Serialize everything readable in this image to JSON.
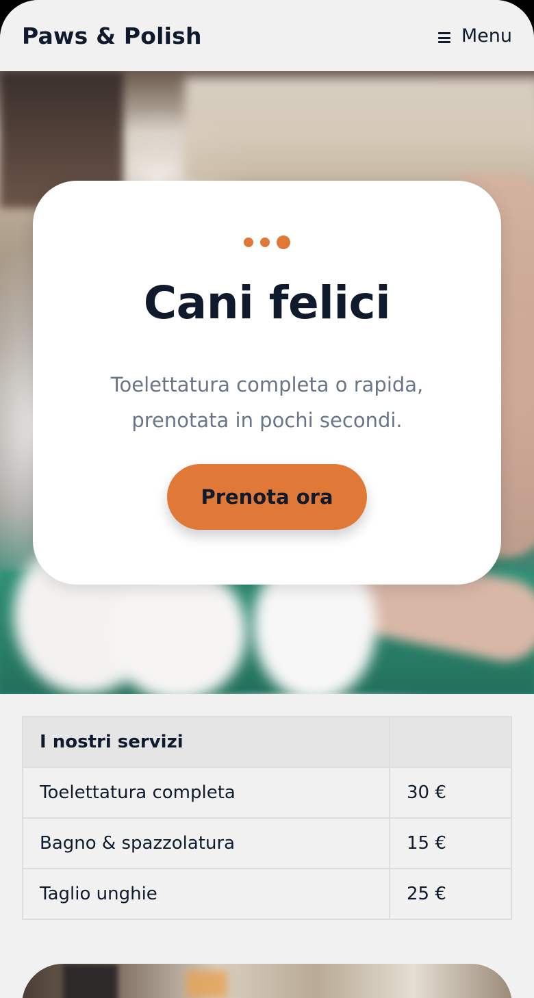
{
  "header": {
    "brand": "Paws & Polish",
    "menu_label": "Menu",
    "menu_icon": "hamburger-icon"
  },
  "hero": {
    "image": "dog-grooming-photo",
    "slider": {
      "count": 3,
      "active_index": 2
    },
    "title": "Cani felici",
    "subtitle": "Toelettatura completa o rapida, prenotata in pochi secondi.",
    "cta_label": "Prenota ora"
  },
  "services": {
    "header": [
      "I nostri servizi",
      ""
    ],
    "rows": [
      {
        "name": "Toelettatura completa",
        "price": "30 €"
      },
      {
        "name": "Bagno & spazzolatura",
        "price": "15 €"
      },
      {
        "name": "Taglio unghie",
        "price": "25 €"
      }
    ]
  },
  "colors": {
    "accent": "#e07838",
    "text_dark": "#0f1b2d",
    "text_muted": "#6a7588",
    "page_bg": "#f1f1f1"
  }
}
